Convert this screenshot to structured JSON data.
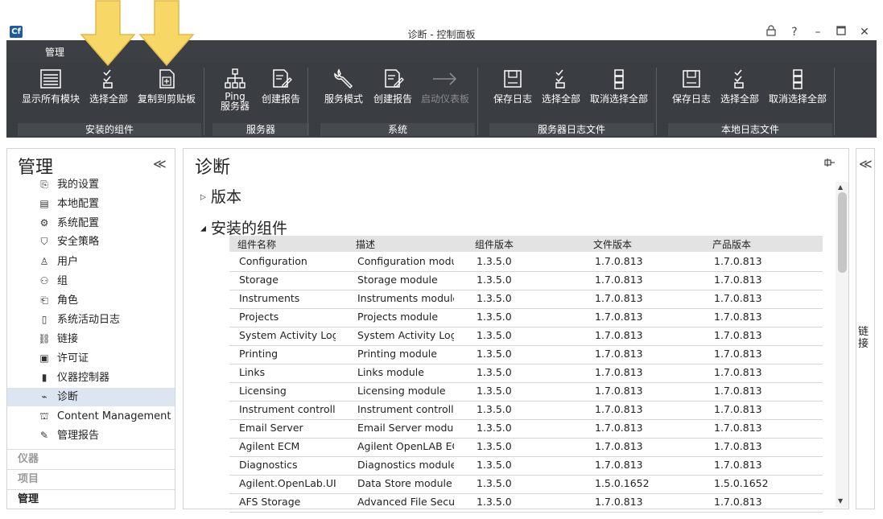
{
  "window": {
    "logo": "Cf",
    "title": "诊断 - 控制面板",
    "buttons": [
      "lock-icon",
      "help-icon",
      "minimize-icon",
      "maximize-icon",
      "close-icon"
    ],
    "help": "?",
    "minimize": "–",
    "close": "✕"
  },
  "ribbon": {
    "tab": "管理",
    "buttons": {
      "show_all": "显示所有模块",
      "select_all_1": "选择全部",
      "copy_clipboard": "复制到剪贴板",
      "ping_1": "Ping",
      "ping_2": "服务器",
      "create_report_1": "创建报告",
      "service_mode": "服务模式",
      "create_report_2": "创建报告",
      "launch_dashboard": "启动仪表板",
      "save_log_1": "保存日志",
      "select_all_2": "选择全部",
      "deselect_all_1": "取消选择全部",
      "save_log_2": "保存日志",
      "select_all_3": "选择全部",
      "deselect_all_2": "取消选择全部"
    },
    "groups": {
      "installed": "安装的组件",
      "server": "服务器",
      "system": "系统",
      "server_log": "服务器日志文件",
      "local_log": "本地日志文件"
    }
  },
  "left": {
    "title": "管理",
    "collapse": "≪",
    "items": [
      {
        "label": "我的设置",
        "icon": "settings-doc-icon"
      },
      {
        "label": "本地配置",
        "icon": "local-config-icon"
      },
      {
        "label": "系统配置",
        "icon": "gear-icon"
      },
      {
        "label": "安全策略",
        "icon": "shield-icon"
      },
      {
        "label": "用户",
        "icon": "user-icon"
      },
      {
        "label": "组",
        "icon": "group-icon"
      },
      {
        "label": "角色",
        "icon": "role-icon"
      },
      {
        "label": "系统活动日志",
        "icon": "log-icon"
      },
      {
        "label": "链接",
        "icon": "link-icon"
      },
      {
        "label": "许可证",
        "icon": "license-icon"
      },
      {
        "label": "仪器控制器",
        "icon": "controller-icon"
      },
      {
        "label": "诊断",
        "icon": "diagnostics-icon"
      },
      {
        "label": "Content Management",
        "icon": "content-icon"
      },
      {
        "label": "管理报告",
        "icon": "report-icon"
      }
    ],
    "sections": [
      "仪器",
      "项目",
      "管理"
    ]
  },
  "main": {
    "title": "诊断",
    "version_section": "版本",
    "installed_section": "安装的组件",
    "columns": [
      "组件名称",
      "描述",
      "组件版本",
      "文件版本",
      "产品版本"
    ],
    "rows": [
      [
        "Configuration",
        "Configuration modul",
        "1.3.5.0",
        "1.7.0.813",
        "1.7.0.813"
      ],
      [
        "Storage",
        "Storage module",
        "1.3.5.0",
        "1.7.0.813",
        "1.7.0.813"
      ],
      [
        "Instruments",
        "Instruments module",
        "1.3.5.0",
        "1.7.0.813",
        "1.7.0.813"
      ],
      [
        "Projects",
        "Projects module",
        "1.3.5.0",
        "1.7.0.813",
        "1.7.0.813"
      ],
      [
        "System Activity Log",
        "System Activity Log r",
        "1.3.5.0",
        "1.7.0.813",
        "1.7.0.813"
      ],
      [
        "Printing",
        "Printing module",
        "1.3.5.0",
        "1.7.0.813",
        "1.7.0.813"
      ],
      [
        "Links",
        "Links module",
        "1.3.5.0",
        "1.7.0.813",
        "1.7.0.813"
      ],
      [
        "Licensing",
        "Licensing module",
        "1.3.5.0",
        "1.7.0.813",
        "1.7.0.813"
      ],
      [
        "Instrument controlle",
        "Instrument controlle",
        "1.3.5.0",
        "1.7.0.813",
        "1.7.0.813"
      ],
      [
        "Email Server",
        "Email Server module",
        "1.3.5.0",
        "1.7.0.813",
        "1.7.0.813"
      ],
      [
        "Agilent ECM",
        "Agilent OpenLAB EC",
        "1.3.5.0",
        "1.7.0.813",
        "1.7.0.813"
      ],
      [
        "Diagnostics",
        "Diagnostics module",
        "1.3.5.0",
        "1.7.0.813",
        "1.7.0.813"
      ],
      [
        "Agilent.OpenLab.UI.I",
        "Data Store module",
        "1.3.5.0",
        "1.5.0.1652",
        "1.5.0.1652"
      ],
      [
        "AFS Storage",
        "Advanced File Securi",
        "1.3.5.0",
        "1.7.0.813",
        "1.7.0.813"
      ]
    ]
  },
  "right": {
    "label": "链接",
    "collapse": "≪"
  },
  "colors": {
    "ribbon_bg": "#3c3f44",
    "annotation_arrow": "#f5d45a",
    "selected_nav": "#dde6f0"
  }
}
